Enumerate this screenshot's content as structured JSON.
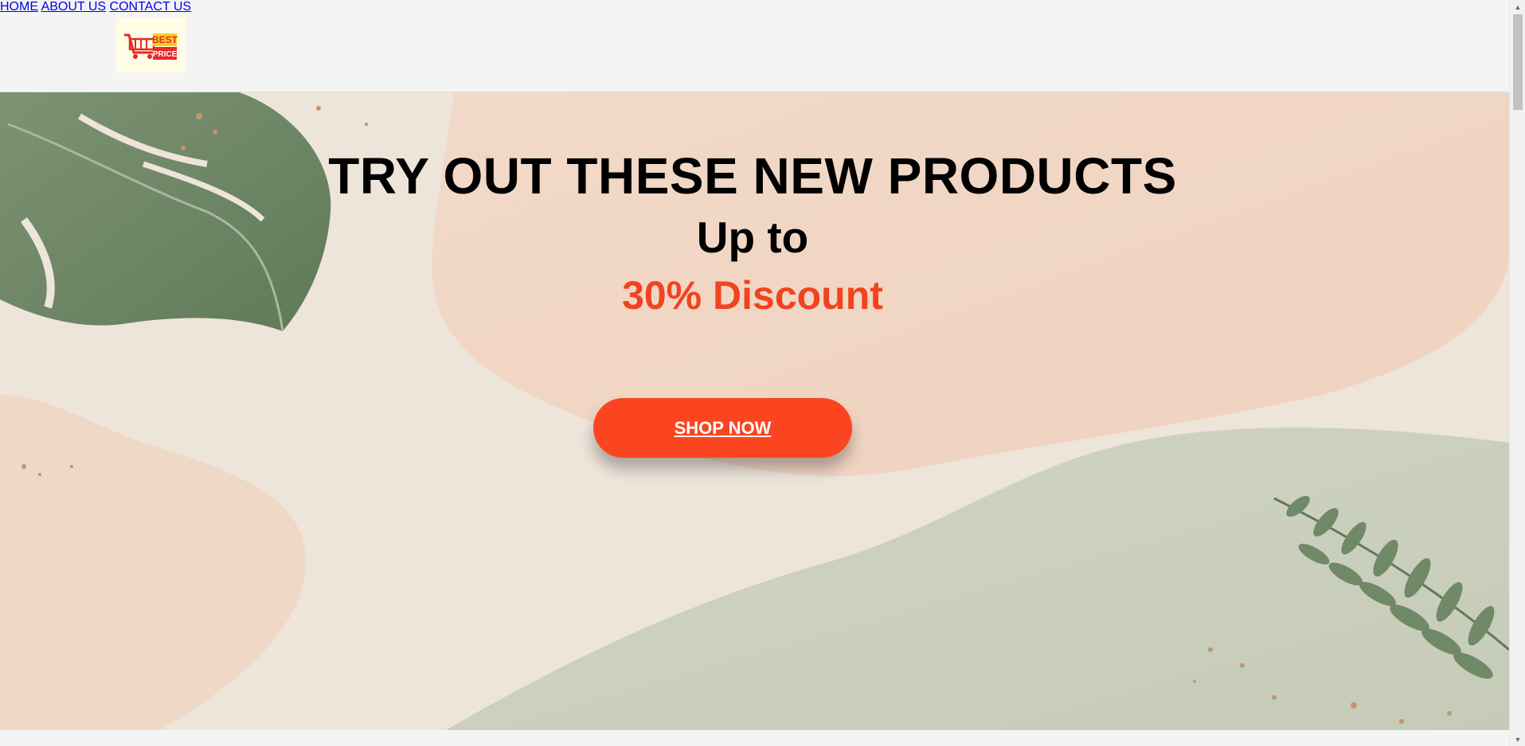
{
  "header": {
    "logo": {
      "line1": "BEST",
      "line2": "PRICE",
      "icon": "shopping-cart-icon"
    },
    "nav": [
      {
        "label": "HOME"
      },
      {
        "label": "ABOUT US"
      },
      {
        "label": "CONTACT US"
      }
    ]
  },
  "hero": {
    "headline": "TRY OUT THESE NEW PRODUCTS",
    "subheadline": "Up to",
    "discount": "30% Discount",
    "cta_label": "SHOP NOW"
  },
  "colors": {
    "accent": "#fb4521",
    "discount_text": "#f2431f",
    "header_bg": "#f4f4f4",
    "nav_text": "#3c3c3c"
  }
}
